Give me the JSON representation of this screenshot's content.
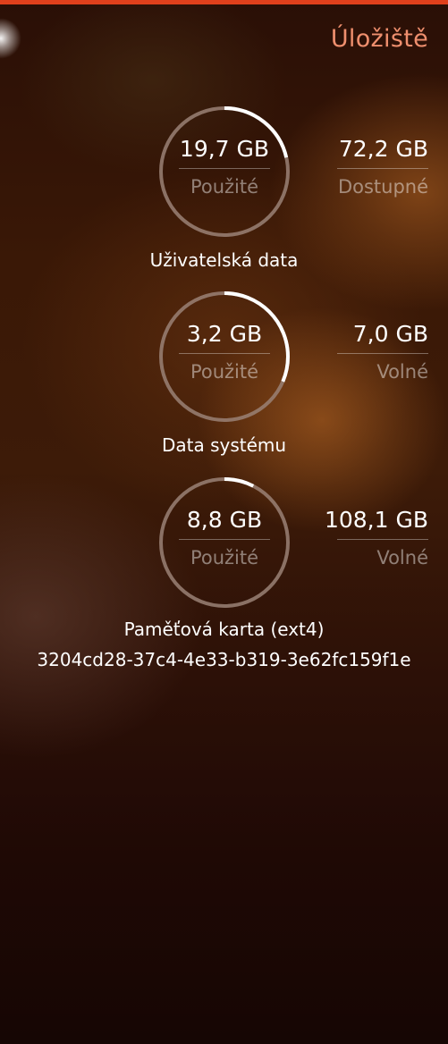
{
  "header": {
    "title": "Úložiště"
  },
  "storages": [
    {
      "used": "19,7 GB",
      "used_label": "Použité",
      "available": "72,2 GB",
      "available_label": "Dostupné",
      "usage_fraction": 0.214,
      "name": "Uživatelská data"
    },
    {
      "used": "3,2 GB",
      "used_label": "Použité",
      "available": "7,0 GB",
      "available_label": "Volné",
      "usage_fraction": 0.314,
      "name": "Data systému"
    },
    {
      "used": "8,8 GB",
      "used_label": "Použité",
      "available": "108,1 GB",
      "available_label": "Volné",
      "usage_fraction": 0.075,
      "name": "Paměťová karta (ext4)",
      "device_id": "3204cd28-37c4-4e33-b319-3e62fc159f1e"
    }
  ],
  "colors": {
    "accent_title": "#ef8f6e",
    "top_bar": "#e0401c",
    "ring_track": "#9a8176",
    "ring_fill": "#ffffff"
  }
}
